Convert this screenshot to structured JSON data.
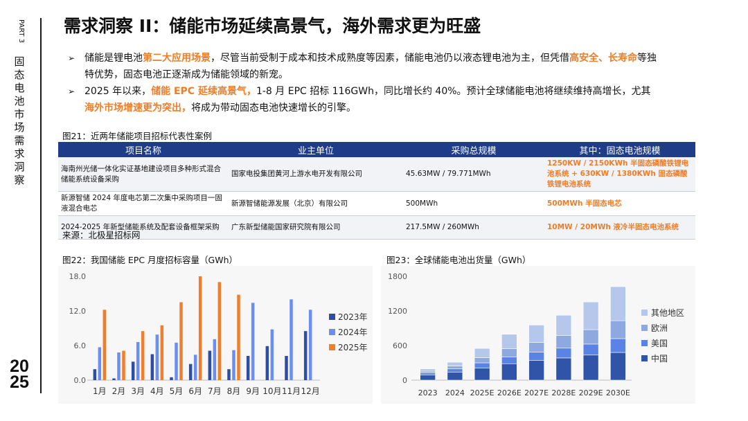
{
  "side": {
    "part": "PART 3",
    "title_chars": [
      "固",
      "态",
      "电",
      "池",
      "市",
      "场",
      "需",
      "求",
      "洞",
      "察"
    ],
    "year_line1": "20",
    "year_line2": "25"
  },
  "page_title": "需求洞察 II：储能市场延续高景气，海外需求更为旺盛",
  "bullets": [
    {
      "segments": [
        {
          "text": "储能是锂电池",
          "hl": false
        },
        {
          "text": "第二大应用场景",
          "hl": true
        },
        {
          "text": "，尽管当前受制于成本和技术成熟度等因素，储能电池仍以液态锂电池为主，但凭借",
          "hl": false
        },
        {
          "text": "高安全、长寿命",
          "hl": true
        },
        {
          "text": "等独特优势，固态电池正逐渐成为储能领域的新宠。",
          "hl": false
        }
      ]
    },
    {
      "segments": [
        {
          "text": "2025 年以来，",
          "hl": false
        },
        {
          "text": "储能 EPC 延续高景气，",
          "hl": true
        },
        {
          "text": "1-8 月 EPC 招标 116GWh，同比增长约 40%。预计全球储能电池将继续维持高增长，尤其",
          "hl": false
        },
        {
          "text": "海外市场增速更为突出，",
          "hl": true
        },
        {
          "text": "将成为带动固态电池快速增长的引擎。",
          "hl": false
        }
      ]
    }
  ],
  "bullet_marker": "➢",
  "table": {
    "caption": "图21：近两年储能项目招标代表性案例",
    "headers": [
      "项目名称",
      "业主单位",
      "采购总规模",
      "其中：固态电池规模"
    ],
    "rows": [
      [
        "海南州光储一体化实证基地建设项目多种形式混合储能系统设备采购",
        "国家电投集团黄河上游水电开发有限公司",
        "45.63MW / 79.771MWh",
        "1250KW / 2150KWh 半固态磷酸铁锂电池系统 + 630KW / 1380KWh 固态磷酸铁锂电池系统"
      ],
      [
        "新源智储 2024 年度电芯第二次集中采购项目一固液混合电芯",
        "新源智储能源发展（北京）有限公司",
        "500MWh",
        "500MWh 半固态电芯"
      ],
      [
        "2024-2025 年新型储能系统及配套设备框架采购",
        "广东新型储能国家研究院有限公司",
        "217.5MW / 260MWh",
        "10MW / 20MWh 液冷半固态电池系统"
      ]
    ],
    "source": "来源：北极星招标网"
  },
  "colors": {
    "header_blue": "#1f3c88",
    "highlight_orange": "#ee7d28",
    "c2023": "#2f4ea3",
    "c2024": "#6b8ff0",
    "c2025": "#ef7f2e",
    "china": "#2f54a8",
    "us": "#5b83e6",
    "europe": "#8ea8e0",
    "other": "#b6c7ec"
  },
  "chart_data": [
    {
      "type": "bar",
      "title": "图22：我国储能 EPC 月度招标容量（GWh）",
      "categories": [
        "1月",
        "2月",
        "3月",
        "4月",
        "5月",
        "6月",
        "7月",
        "8月",
        "9月",
        "10月",
        "11月",
        "12月"
      ],
      "series": [
        {
          "name": "2023年",
          "values": [
            1.9,
            0.3,
            3.2,
            4.5,
            0.5,
            2.8,
            5.1,
            1.9,
            4.2,
            5.9,
            4.2,
            8.5
          ]
        },
        {
          "name": "2024年",
          "values": [
            5.7,
            4.8,
            6.6,
            7.9,
            6.5,
            4.4,
            7.1,
            5.2,
            13.4,
            8.8,
            14.0,
            12.2
          ]
        },
        {
          "name": "2025年",
          "values": [
            12.2,
            5.1,
            8.5,
            9.5,
            13.5,
            18.0,
            17.0,
            14.8,
            null,
            null,
            null,
            null
          ]
        }
      ],
      "yticks": [
        "0.0",
        "6.0",
        "12.0",
        "18.0"
      ],
      "ylim": [
        0,
        18
      ],
      "legend": "right"
    },
    {
      "type": "bar",
      "stacked": true,
      "title": "图23：全球储能电池出货量（GWh）",
      "categories": [
        "2023",
        "2024",
        "2025E",
        "2026E",
        "2027E",
        "2028E",
        "2029E",
        "2030E"
      ],
      "series": [
        {
          "name": "中国",
          "values": [
            90,
            140,
            210,
            285,
            340,
            385,
            435,
            480
          ]
        },
        {
          "name": "美国",
          "values": [
            35,
            55,
            90,
            115,
            145,
            170,
            190,
            240
          ]
        },
        {
          "name": "欧洲",
          "values": [
            30,
            50,
            90,
            145,
            170,
            220,
            250,
            310
          ]
        },
        {
          "name": "其他地区",
          "values": [
            40,
            65,
            160,
            250,
            300,
            350,
            480,
            590
          ]
        }
      ],
      "legend_order": [
        "其他地区",
        "欧洲",
        "美国",
        "中国"
      ],
      "yticks": [
        "0",
        "600",
        "1200",
        "1800"
      ],
      "ylim": [
        0,
        1800
      ],
      "legend": "right"
    }
  ]
}
